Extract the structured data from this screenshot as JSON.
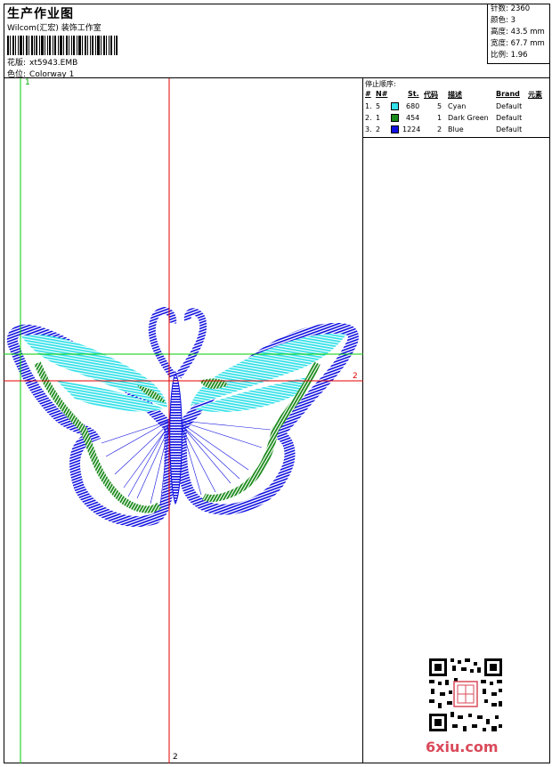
{
  "header": {
    "title": "生产作业图",
    "company": "Wilcom(汇宏) 装饰工作室",
    "design_label": "花版:",
    "design_value": "xt5943.EMB",
    "colorway_label": "色位:",
    "colorway_value": "Colorway 1"
  },
  "stats": {
    "stitches_label": "针数:",
    "stitches_value": "2360",
    "colors_label": "颜色:",
    "colors_value": "3",
    "height_label": "高度:",
    "height_value": "43.5 mm",
    "width_label": "宽度:",
    "width_value": "67.7 mm",
    "scale_label": "比例:",
    "scale_value": "1.96"
  },
  "stop_sequence": {
    "title": "停止顺序:",
    "headers": [
      "#",
      "N#",
      "St.",
      "代码",
      "描述",
      "Brand",
      "元素"
    ],
    "rows": [
      {
        "idx": "1.",
        "n": "5",
        "color": "#33e0e8",
        "st": "680",
        "code": "5",
        "desc": "Cyan",
        "brand": "Default"
      },
      {
        "idx": "2.",
        "n": "1",
        "color": "#1a8a1a",
        "st": "454",
        "code": "1",
        "desc": "Dark Green",
        "brand": "Default"
      },
      {
        "idx": "3.",
        "n": "2",
        "color": "#1010e0",
        "st": "1224",
        "code": "2",
        "desc": "Blue",
        "brand": "Default"
      }
    ]
  },
  "axes": {
    "green_top": "1",
    "red_right": "2",
    "red_bottom": "2"
  },
  "watermark": "6xiu.com",
  "colors": {
    "cyan": "#33e0e8",
    "green": "#1a8a1a",
    "blue": "#1010e0",
    "guide_green": "#00cc00",
    "guide_red": "#e00000"
  }
}
